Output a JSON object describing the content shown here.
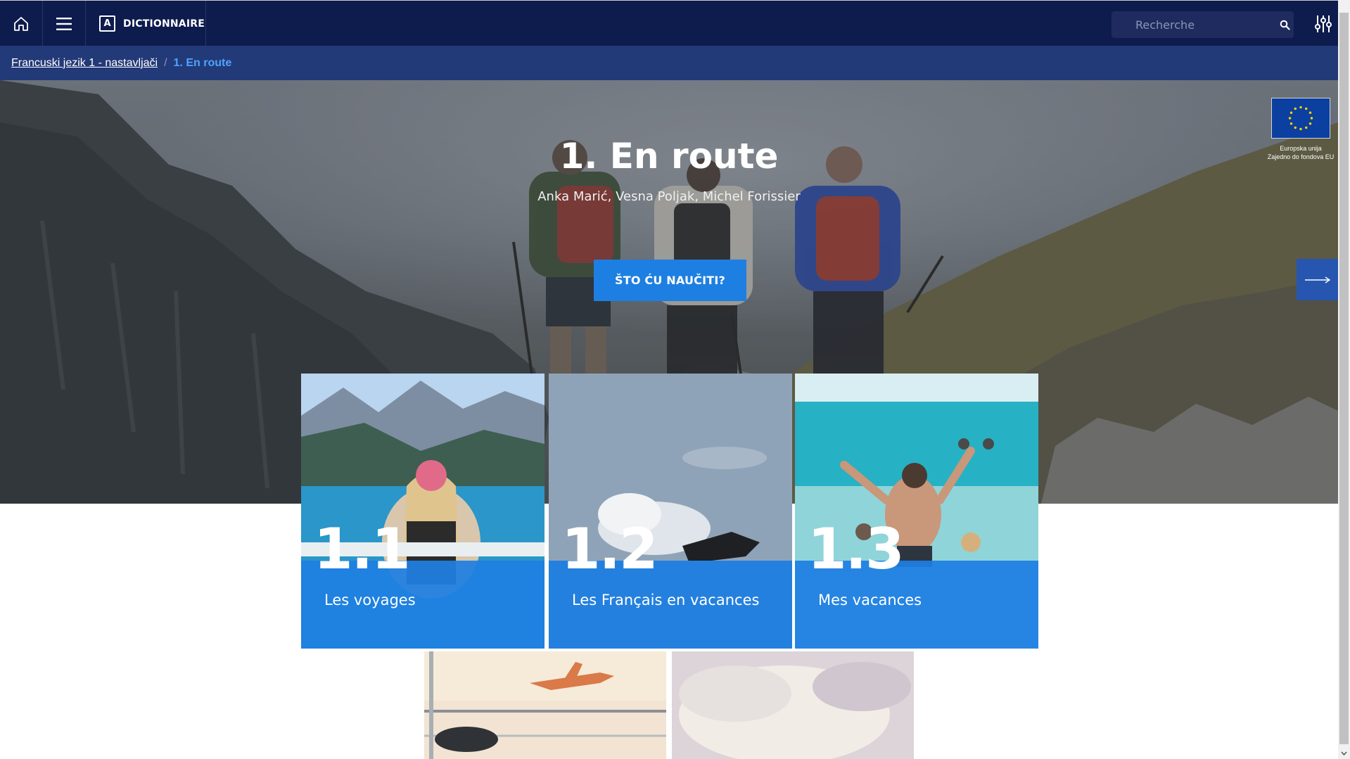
{
  "topbar": {
    "home_icon": "home-icon",
    "menu_icon": "hamburger-menu-icon",
    "dictionary": {
      "box_letter": "A",
      "label": "DICTIONNAIRE"
    },
    "search": {
      "placeholder": "Recherche",
      "value": ""
    },
    "settings_icon": "sliders-icon",
    "background": "#0e1b4d"
  },
  "breadcrumb": {
    "parent": "Francuski jezik 1 - nastavljači",
    "separator": "/",
    "current": "1. En route"
  },
  "hero": {
    "title": "1. En route",
    "authors": "Anka Marić, Vesna Poljak, Michel Forissier",
    "cta_label": "ŠTO ĆU NAUČITI?",
    "next_icon": "arrow-right-icon",
    "eu_badge": {
      "line1": "Europska unija",
      "line2": "Zajedno do fondova EU"
    }
  },
  "cards": [
    {
      "number": "1.1",
      "title": "Les voyages"
    },
    {
      "number": "1.2",
      "title": "Les Français en vacances"
    },
    {
      "number": "1.3",
      "title": "Mes vacances"
    }
  ],
  "colors": {
    "navy": "#0e1b4d",
    "breadcrumb_bg": "#233a78",
    "accent_blue": "#1e7fe2",
    "breadcrumb_current": "#4ea3ff"
  }
}
